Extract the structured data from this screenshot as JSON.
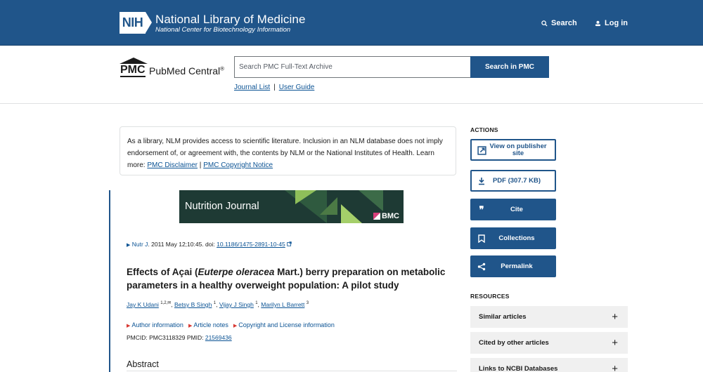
{
  "header": {
    "logo_text": "NIH",
    "org_title": "National Library of Medicine",
    "org_subtitle": "National Center for Biotechnology Information",
    "search_label": "Search",
    "login_label": "Log in"
  },
  "pmc": {
    "logo_short": "PMC",
    "logo_name": "PubMed Central",
    "logo_reg": "®",
    "search_placeholder": "Search PMC Full-Text Archive",
    "search_button": "Search in PMC",
    "links": {
      "journal_list": "Journal List",
      "separator": "|",
      "user_guide": "User Guide"
    }
  },
  "disclaimer": {
    "text": "As a library, NLM provides access to scientific literature. Inclusion in an NLM database does not imply endorsement of, or agreement with, the contents by NLM or the National Institutes of Health.",
    "learn_more": "Learn more:",
    "link1": "PMC Disclaimer",
    "sep": "|",
    "link2": "PMC Copyright Notice"
  },
  "banner": {
    "journal": "Nutrition Journal",
    "publisher": "BMC"
  },
  "citation": {
    "journal": "Nutr J",
    "details": ". 2011 May 12;10:45. doi: ",
    "doi": "10.1186/1475-2891-10-45"
  },
  "article": {
    "title_part1": "Effects of Açai (",
    "title_italic": "Euterpe oleracea",
    "title_part2": " Mart.) berry preparation on metabolic parameters in a healthy overweight population: A pilot study",
    "authors": [
      {
        "name": "Jay K Udani",
        "sup": "1,2,✉"
      },
      {
        "name": "Betsy B Singh",
        "sup": "1"
      },
      {
        "name": "Vijay J Singh",
        "sup": "1"
      },
      {
        "name": "Marilyn L Barrett",
        "sup": "3"
      }
    ],
    "info_links": [
      "Author information",
      "Article notes",
      "Copyright and License information"
    ],
    "pmcid_label": "PMCID: PMC3118329",
    "pmid_label": "PMID:",
    "pmid": "21569436",
    "abstract_heading": "Abstract"
  },
  "sidebar": {
    "actions_heading": "ACTIONS",
    "actions": [
      {
        "label": "View on publisher site",
        "icon": "external-link-icon"
      },
      {
        "label": "PDF (307.7 KB)",
        "icon": "download-icon"
      },
      {
        "label": "Cite",
        "icon": "quote-icon"
      },
      {
        "label": "Collections",
        "icon": "bookmark-icon"
      },
      {
        "label": "Permalink",
        "icon": "share-icon"
      }
    ],
    "resources_heading": "RESOURCES",
    "resources": [
      {
        "label": "Similar articles"
      },
      {
        "label": "Cited by other articles"
      },
      {
        "label": "Links to NCBI Databases"
      }
    ],
    "expand_symbol": "+"
  },
  "colors": {
    "primary": "#20558a",
    "link": "#0b5394",
    "caret_red": "#d83933",
    "banner_bg": "#1e3a34",
    "row_bg": "#f0f0f0"
  }
}
